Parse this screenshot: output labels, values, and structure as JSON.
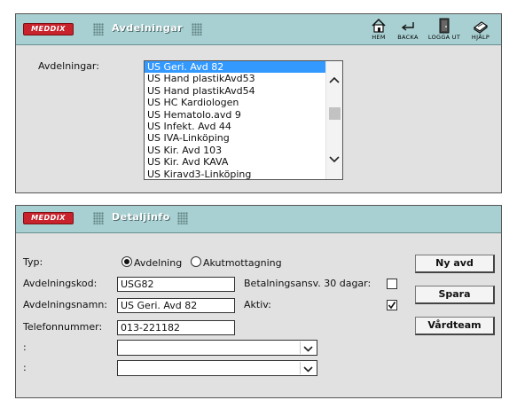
{
  "colors": {
    "header_bg": "#a8cfd1",
    "panel_bg": "#e1e1e1",
    "logo_red": "#c8232c",
    "selection": "#3399ff"
  },
  "logo_text": "MEDDIX",
  "toolbar": [
    {
      "label": "HEM",
      "icon": "home-icon"
    },
    {
      "label": "BACKA",
      "icon": "back-arrow-icon"
    },
    {
      "label": "LOGGA UT",
      "icon": "door-icon"
    },
    {
      "label": "HJÄLP",
      "icon": "help-book-icon"
    }
  ],
  "avdelningar_panel": {
    "title": "Avdelningar",
    "list_label": "Avdelningar:",
    "items": [
      "US Geri. Avd 82",
      "US Hand plastikAvd53",
      "US Hand plastikAvd54",
      "US HC Kardiologen",
      "US Hematolo.avd 9",
      "US Infekt. Avd 44",
      "US IVA-Linköping",
      "US Kir. Avd 103",
      "US Kir. Avd KAVA",
      "US Kiravd3-Linköping"
    ],
    "selected_index": 0
  },
  "detalj_panel": {
    "title": "Detaljinfo",
    "typ_label": "Typ:",
    "radio_options": [
      "Avdelning",
      "Akutmottagning"
    ],
    "radio_selected": "Avdelning",
    "kod_label": "Avdelningskod:",
    "kod_value": "USG82",
    "namn_label": "Avdelningsnamn:",
    "namn_value": "US Geri. Avd 82",
    "tel_label": "Telefonnummer:",
    "tel_value": "013-221182",
    "select1_label": ":",
    "select1_value": "",
    "select2_label": ":",
    "select2_value": "",
    "betal_label": "Betalningsansv. 30 dagar:",
    "betal_checked": false,
    "aktiv_label": "Aktiv:",
    "aktiv_checked": true,
    "buttons": {
      "ny": "Ny avd",
      "spara": "Spara",
      "vardteam": "Vårdteam"
    }
  }
}
